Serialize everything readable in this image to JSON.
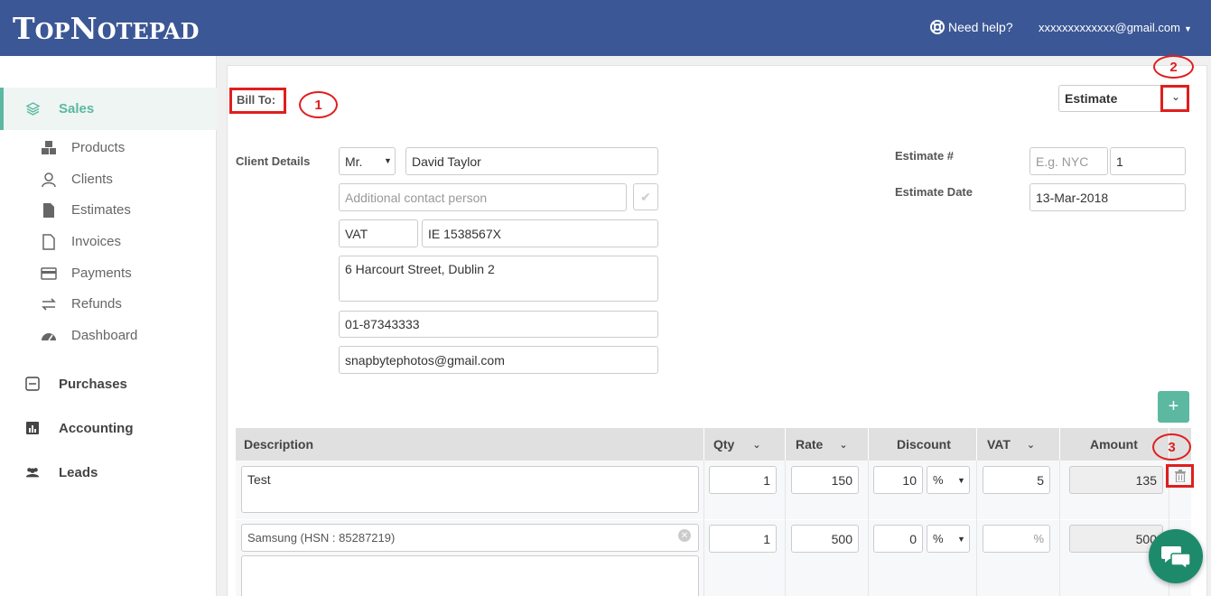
{
  "header": {
    "logo": {
      "first_big": "T",
      "first_small": "OP",
      "second_big": "N",
      "second_small": "OTEPAD"
    },
    "help_label": "Need help?",
    "user_email": "xxxxxxxxxxxxx@gmail.com",
    "background": "#3b5795"
  },
  "sidebar": {
    "active_color": "#5cb8a0",
    "sales_label": "Sales",
    "sub_items": [
      {
        "label": "Products",
        "icon": "boxes-icon"
      },
      {
        "label": "Clients",
        "icon": "clients-icon"
      },
      {
        "label": "Estimates",
        "icon": "document-icon"
      },
      {
        "label": "Invoices",
        "icon": "file-icon"
      },
      {
        "label": "Payments",
        "icon": "card-icon"
      },
      {
        "label": "Refunds",
        "icon": "exchange-icon"
      },
      {
        "label": "Dashboard",
        "icon": "dashboard-icon"
      }
    ],
    "purchases_label": "Purchases",
    "accounting_label": "Accounting",
    "leads_label": "Leads"
  },
  "form": {
    "bill_to_label": "Bill To:",
    "doc_type_value": "Estimate",
    "client_details_label": "Client Details",
    "salutation": "Mr.",
    "client_name": "David Taylor",
    "contact_placeholder": "Additional contact person",
    "tax_type": "VAT",
    "tax_number": "IE 1538567X",
    "address": "6 Harcourt Street, Dublin 2",
    "phone": "01-87343333",
    "email": "snapbytephotos@gmail.com",
    "estimate_number_label": "Estimate #",
    "estimate_prefix_placeholder": "E.g. NYC",
    "estimate_number": "1",
    "estimate_date_label": "Estimate Date",
    "estimate_date": "13-Mar-2018"
  },
  "annotations": {
    "one": "1",
    "two": "2",
    "three": "3"
  },
  "table": {
    "headers": {
      "description": "Description",
      "qty": "Qty",
      "rate": "Rate",
      "discount": "Discount",
      "vat": "VAT",
      "amount": "Amount"
    },
    "rows": [
      {
        "description": "Test",
        "qty": "1",
        "rate": "150",
        "discount": "10",
        "discount_type": "%",
        "vat": "5",
        "vat_placeholder": "",
        "amount": "135"
      },
      {
        "description": "Samsung (HSN : 85287219)",
        "qty": "1",
        "rate": "500",
        "discount": "0",
        "discount_type": "%",
        "vat": "",
        "vat_placeholder": "%",
        "amount": "500"
      }
    ]
  }
}
